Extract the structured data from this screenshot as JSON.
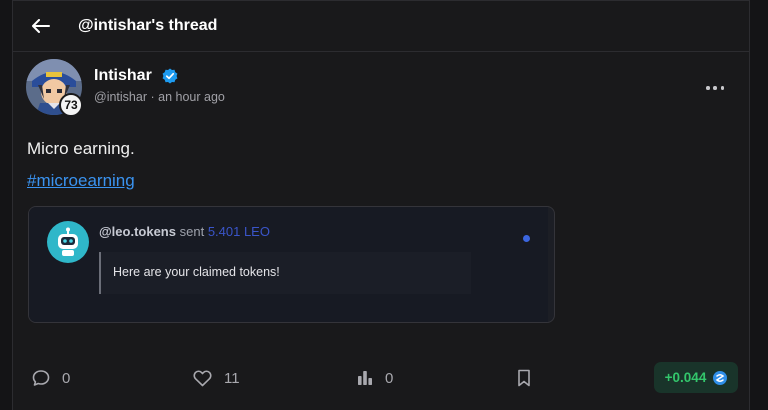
{
  "header": {
    "title": "@intishar's thread"
  },
  "post": {
    "author_name": "Intishar",
    "avatar_badge": "73",
    "handle": "@intishar",
    "separator": "·",
    "time": "an hour ago",
    "body_text": "Micro earning.",
    "hashtag": "#microearning"
  },
  "embed": {
    "sender": "@leo.tokens",
    "verb": "sent",
    "amount": "5.401 LEO",
    "message": "Here are your claimed tokens!"
  },
  "footer": {
    "comments": "0",
    "likes": "11",
    "stats": "0",
    "payout": "+0.044"
  },
  "icons": {
    "back": "arrow-left-icon",
    "verified": "verified-check-icon",
    "more": "more-horizontal-icon",
    "comment": "comment-icon",
    "like": "heart-icon",
    "stats": "bar-chart-icon",
    "bookmark": "bookmark-icon",
    "hive": "hive-coin-icon"
  },
  "colors": {
    "accent_link": "#3a93f0",
    "verified": "#1d9bf0",
    "payout_green": "#33c76c",
    "amount_blue": "#3a55c9"
  }
}
